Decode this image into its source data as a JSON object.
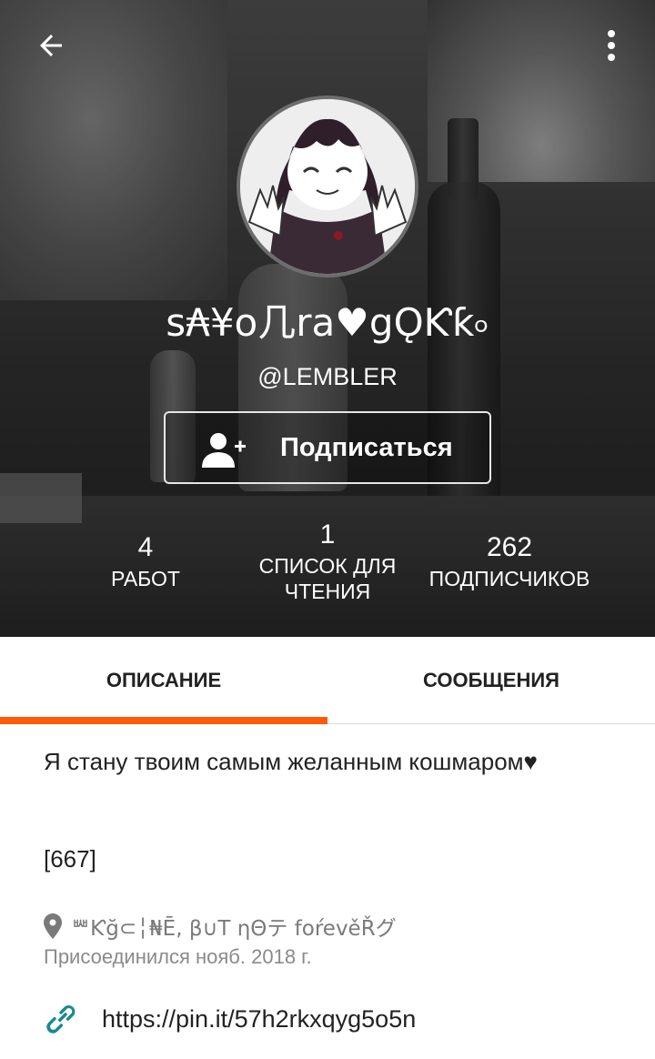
{
  "profile": {
    "display_name": "s₳¥o几ra♥gǪƘƙ৹",
    "username": "@LEMBLER",
    "follow_label": "Подписаться"
  },
  "stats": [
    {
      "value": "4",
      "label": "РАБОТ"
    },
    {
      "value": "1",
      "label": "СПИСОК ДЛЯ ЧТЕНИЯ"
    },
    {
      "value": "262",
      "label": "ПОДПИСЧИКОВ"
    }
  ],
  "tabs": {
    "about": "ОПИСАНИЕ",
    "messages": "СООБЩЕНИЯ",
    "active": "about"
  },
  "about": {
    "bio": "Я стану твоим самым желанным кошмаром♥",
    "code": "[667]",
    "location": "ᄤƘğ⊂╎₦Ē, β∪Τ ηΘテ foŕevěŘグ",
    "joined": "Присоединился нояб. 2018 г.",
    "link": "https://pin.it/57h2rkxqyg5o5n"
  },
  "icons": {
    "back": "arrow-left-icon",
    "more": "more-vertical-icon",
    "follow": "add-user-icon",
    "location": "map-pin-icon",
    "link": "link-icon"
  },
  "colors": {
    "accent": "#ff5a0a",
    "link_icon": "#1a8a8a",
    "location_icon": "#7a7a7a"
  }
}
